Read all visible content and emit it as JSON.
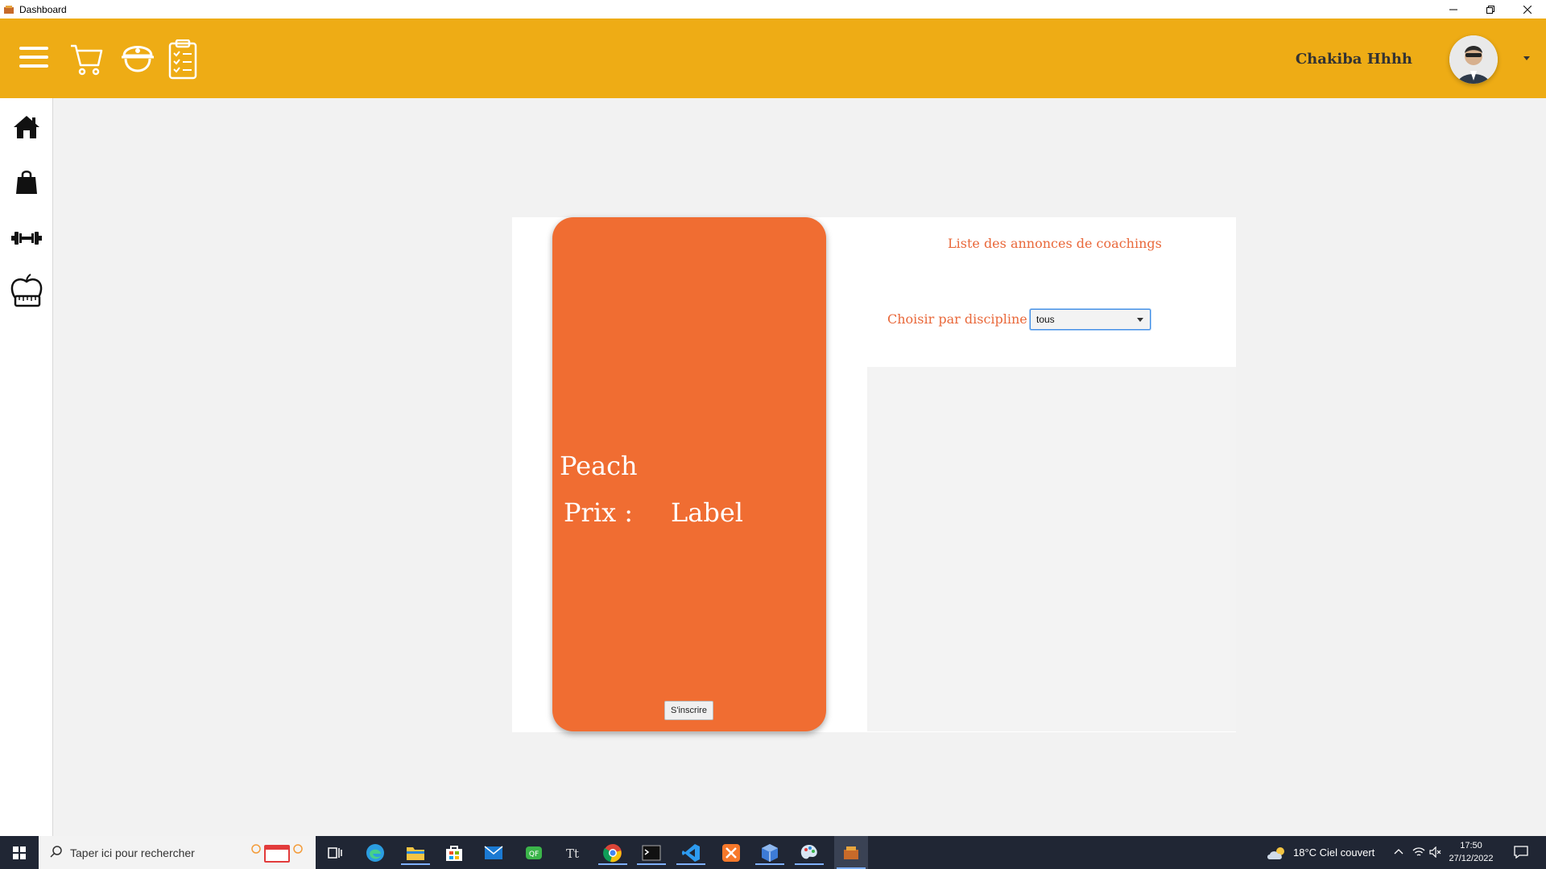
{
  "window": {
    "title": "Dashboard"
  },
  "header": {
    "user_name": "Chakiba Hhhh",
    "accent_color": "#eeac15"
  },
  "sidebar": {
    "items": [
      {
        "icon": "home-icon"
      },
      {
        "icon": "shopping-bag-icon"
      },
      {
        "icon": "dumbbell-icon"
      },
      {
        "icon": "apple-scale-icon"
      }
    ]
  },
  "card": {
    "name": "Peach",
    "price_label": "Prix :",
    "price_value": "Label",
    "signup_label": "S'inscrire",
    "color": "#f06d32"
  },
  "panel": {
    "title": "Liste des annonces de coachings",
    "filter_label": "Choisir par discipline",
    "filter_value": "tous"
  },
  "taskbar": {
    "search_placeholder": "Taper ici pour rechercher",
    "weather": "18°C  Ciel couvert",
    "time": "17:50",
    "date": "27/12/2022"
  }
}
